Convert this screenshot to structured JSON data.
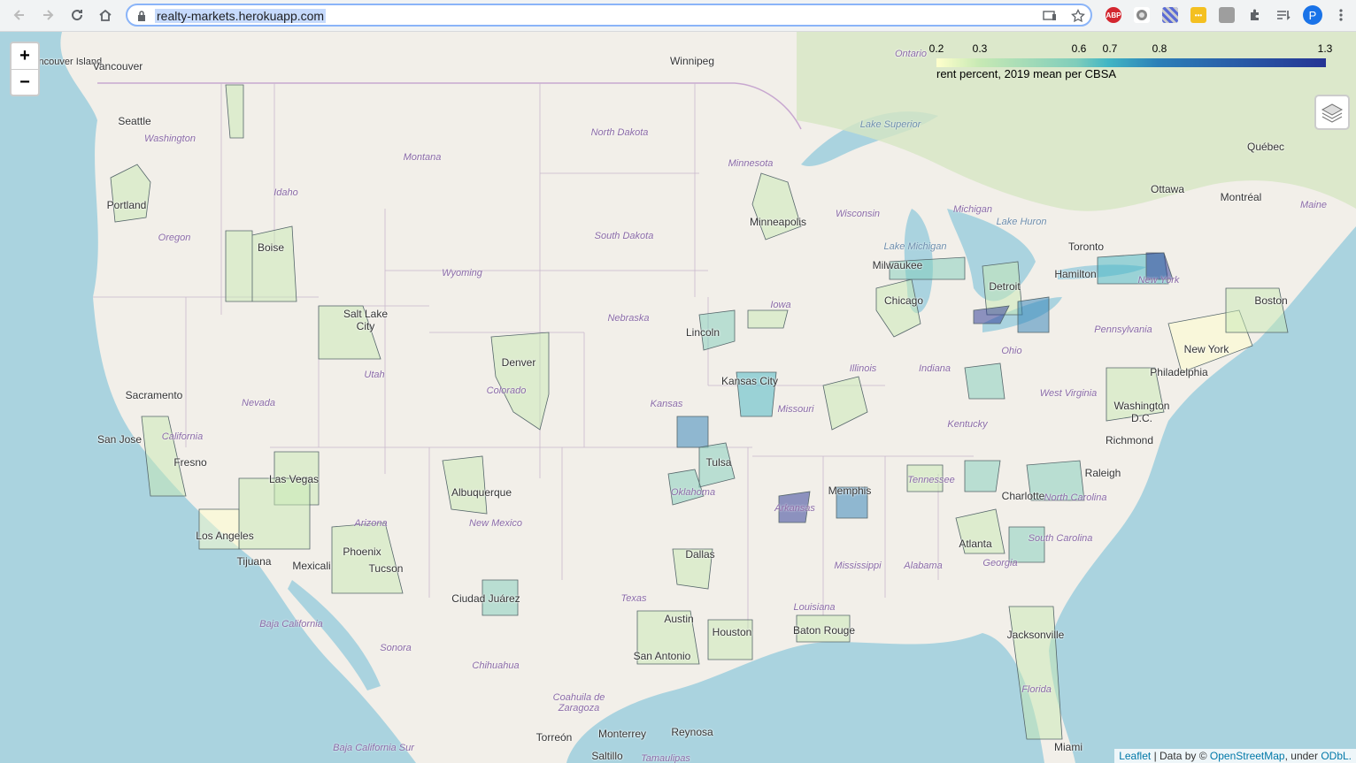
{
  "browser": {
    "url": "realty-markets.herokuapp.com",
    "profile_initial": "P",
    "extensions": [
      "adblock-icon",
      "circle-extension-icon",
      "pattern-extension-icon",
      "yellow-extension-icon",
      "gray-extension-icon",
      "puzzle-icon",
      "reading-list-icon"
    ]
  },
  "map": {
    "zoom_in": "+",
    "zoom_out": "−",
    "legend": {
      "ticks": [
        "0.2",
        "0.3",
        "0.6",
        "0.7",
        "0.8",
        "1.3"
      ],
      "caption": "rent percent, 2019 mean per CBSA",
      "colors": [
        "#ffffcc",
        "#c7e9b4",
        "#7fcdbb",
        "#41b6c4",
        "#2c7fb8",
        "#253494"
      ]
    },
    "attribution": {
      "leaflet": "Leaflet",
      "sep": " | Data by © ",
      "osm": "OpenStreetMap",
      "under": ", under ",
      "odbl": "ODbL."
    },
    "cities": [
      "Vancouver Island",
      "Vancouver",
      "Winnipeg",
      "Ontario",
      "Seattle",
      "Portland",
      "Boise",
      "Salt Lake City",
      "Denver",
      "Lincoln",
      "Kansas City",
      "Minneapolis",
      "Milwaukee",
      "Chicago",
      "Detroit",
      "Hamilton",
      "Toronto",
      "Ottawa",
      "Montréal",
      "Québec",
      "New York",
      "Boston",
      "Philadelphia",
      "Washington D.C.",
      "Richmond",
      "Raleigh",
      "Charlotte",
      "Atlanta",
      "Memphis",
      "Tulsa",
      "Dallas",
      "Austin",
      "Houston",
      "San Antonio",
      "Baton Rouge",
      "Jacksonville",
      "Miami",
      "Albuquerque",
      "Phoenix",
      "Tucson",
      "Las Vegas",
      "Los Angeles",
      "Tijuana",
      "Mexicali",
      "Sacramento",
      "San Jose",
      "Fresno",
      "Ciudad Juárez",
      "Monterrey",
      "Reynosa",
      "Torreón",
      "Saltillo"
    ],
    "regions": [
      "Washington",
      "Oregon",
      "Idaho",
      "Montana",
      "Wyoming",
      "Nevada",
      "California",
      "Utah",
      "Colorado",
      "Arizona",
      "New Mexico",
      "Texas",
      "Oklahoma",
      "Kansas",
      "Nebraska",
      "South Dakota",
      "North Dakota",
      "Minnesota",
      "Iowa",
      "Missouri",
      "Arkansas",
      "Louisiana",
      "Mississippi",
      "Alabama",
      "Georgia",
      "Florida",
      "South Carolina",
      "North Carolina",
      "Tennessee",
      "Kentucky",
      "Illinois",
      "Indiana",
      "Ohio",
      "West Virginia",
      "Pennsylvania",
      "New York",
      "Wisconsin",
      "Michigan",
      "Lake Superior",
      "Lake Michigan",
      "Lake Huron",
      "Maine",
      "Baja California",
      "Sonora",
      "Chihuahua",
      "Coahuila de Zaragoza",
      "Baja California Sur",
      "Tamaulipas"
    ]
  }
}
